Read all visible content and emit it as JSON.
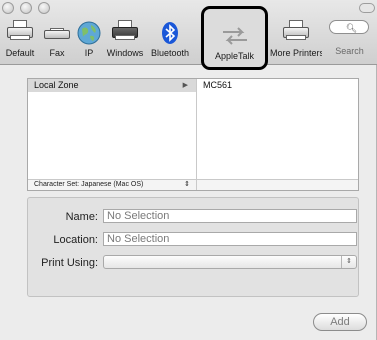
{
  "toolbar": {
    "items": [
      {
        "label": "Default",
        "icon": "default-printer-icon"
      },
      {
        "label": "Fax",
        "icon": "fax-icon"
      },
      {
        "label": "IP",
        "icon": "globe-icon"
      },
      {
        "label": "Windows",
        "icon": "windows-printer-icon"
      },
      {
        "label": "Bluetooth",
        "icon": "bluetooth-icon"
      },
      {
        "label": "AppleTalk",
        "icon": "appletalk-icon",
        "selected": true
      },
      {
        "label": "More Printers",
        "icon": "more-printers-icon"
      },
      {
        "label": "Search",
        "icon": "search-icon"
      }
    ]
  },
  "browser": {
    "zones": [
      {
        "label": "Local Zone"
      }
    ],
    "printers": [
      {
        "label": "MC561"
      }
    ],
    "charset_label": "Character Set:",
    "charset_value": "Japanese (Mac OS)"
  },
  "form": {
    "name_label": "Name:",
    "name_value": "No Selection",
    "location_label": "Location:",
    "location_value": "No Selection",
    "print_using_label": "Print Using:",
    "print_using_value": ""
  },
  "actions": {
    "add_label": "Add"
  },
  "colors": {
    "bluetooth": "#1a57d8",
    "selection_outline": "#000000"
  }
}
